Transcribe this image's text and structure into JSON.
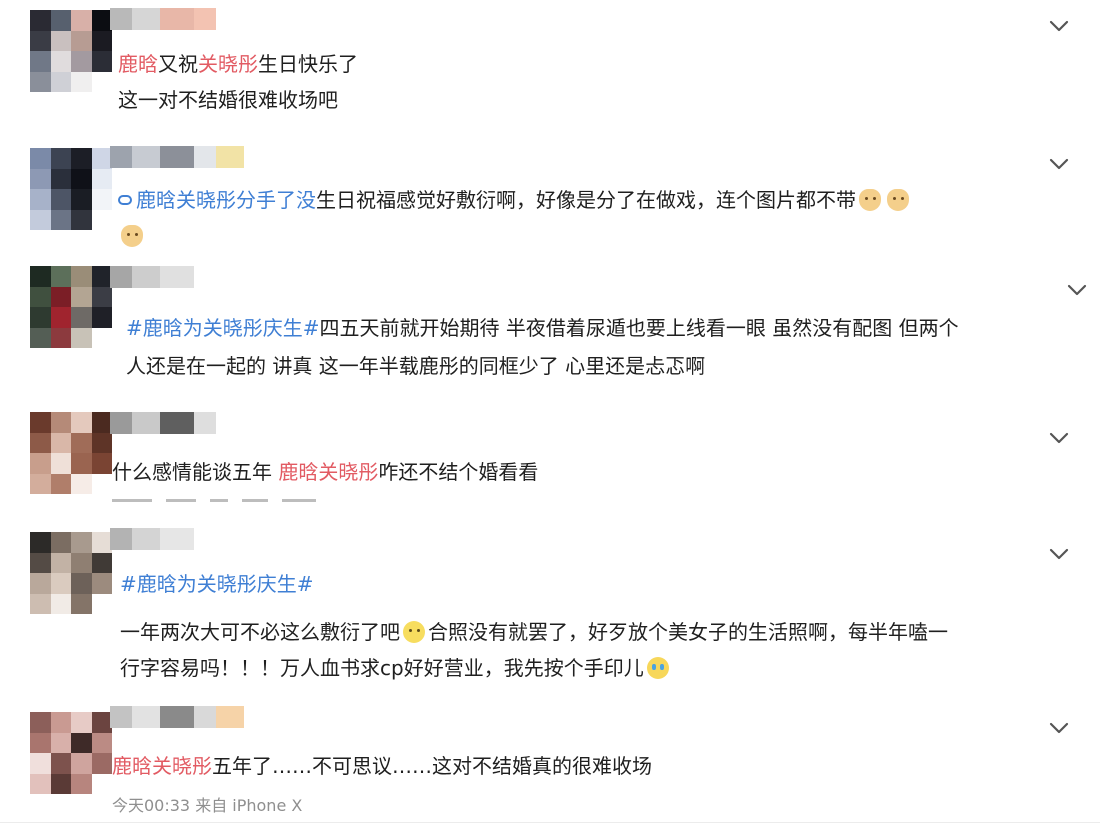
{
  "comments": [
    {
      "text_lines": [
        [
          {
            "t": "鹿晗",
            "c": "kw"
          },
          {
            "t": "又祝"
          },
          {
            "t": "关晓彤",
            "c": "kw"
          },
          {
            "t": "生日快乐了"
          }
        ],
        [
          {
            "t": "这一对不结婚很难收场吧"
          }
        ]
      ]
    },
    {
      "text_lines": [
        [
          {
            "icon": "link-icon"
          },
          {
            "t": "鹿晗关晓彤分手了没",
            "c": "lnk"
          },
          {
            "t": "生日祝福感觉好敷衍啊，好像是分了在做戏，连个图片都不带"
          },
          {
            "emoji": "cat-face-emoji"
          },
          {
            "emoji": "cat-face-emoji"
          }
        ],
        [
          {
            "emoji": "cat-face-emoji"
          }
        ]
      ]
    },
    {
      "text_lines": [
        [
          {
            "t": "#鹿晗为关晓彤庆生#",
            "c": "tag"
          },
          {
            "t": "四五天前就开始期待 半夜借着尿遁也要上线看一眼 虽然没有配图 但两个"
          }
        ],
        [
          {
            "t": "人还是在一起的 讲真 这一年半载鹿彤的同框少了 心里还是忐忑啊"
          }
        ]
      ]
    },
    {
      "text_lines": [
        [
          {
            "t": "什么感情能谈五年 "
          },
          {
            "t": "鹿晗关晓彤",
            "c": "kw"
          },
          {
            "t": "咋还不结个婚看看"
          }
        ]
      ]
    },
    {
      "text_lines": [
        [
          {
            "t": "#鹿晗为关晓彤庆生#",
            "c": "tag"
          }
        ],
        [
          {
            "t": "一年两次大可不必这么敷衍了吧"
          },
          {
            "emoji": "weary-face-emoji"
          },
          {
            "t": "合照没有就罢了，好歹放个美女子的生活照啊，每半年嗑一"
          }
        ],
        [
          {
            "t": "行字容易吗！！！万人血书求cp好好营业，我先按个手印儿"
          },
          {
            "emoji": "crying-face-emoji"
          }
        ]
      ]
    },
    {
      "text_lines": [
        [
          {
            "t": "鹿晗关晓彤",
            "c": "kw"
          },
          {
            "t": "五年了……不可思议……这对不结婚真的很难收场"
          }
        ]
      ],
      "footer": "今天00:33  来自 iPhone X"
    }
  ]
}
